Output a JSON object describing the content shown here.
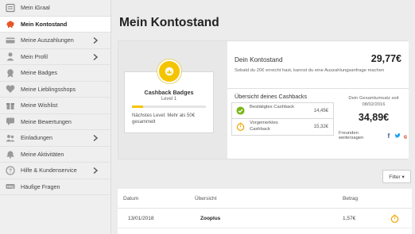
{
  "sidebar": {
    "items": [
      {
        "label": "Mein iGraal",
        "icon": "list-icon"
      },
      {
        "label": "Mein Kontostand",
        "icon": "piggy-bank-icon",
        "active": true
      },
      {
        "label": "Meine Auszahlungen",
        "icon": "card-icon",
        "expandable": true
      },
      {
        "label": "Mein Profil",
        "icon": "user-icon",
        "expandable": true
      },
      {
        "label": "Meine Badges",
        "icon": "badge-icon"
      },
      {
        "label": "Meine Lieblingsshops",
        "icon": "heart-icon"
      },
      {
        "label": "Meine Wishlist",
        "icon": "gift-icon"
      },
      {
        "label": "Meine Bewertungen",
        "icon": "chat-icon"
      },
      {
        "label": "Einladungen",
        "icon": "users-icon",
        "expandable": true
      },
      {
        "label": "Meine Aktivitäten",
        "icon": "bell-icon"
      },
      {
        "label": "Hilfe & Kundenservice",
        "icon": "help-icon",
        "expandable": true
      },
      {
        "label": "Häufige Fragen",
        "icon": "faq-icon"
      }
    ]
  },
  "page": {
    "title": "Mein Kontostand"
  },
  "badge": {
    "title": "Cashback Badges",
    "level": "Level 1",
    "progress": 0.15,
    "next_level": "Nächstes Level: Mehr als 50€ gesammelt"
  },
  "konto": {
    "label": "Dein Kontostand",
    "value": "29,77€",
    "note": "Sobald du 20€ erreicht hast, kannst du eine Auszahlungsanfrage machen"
  },
  "cashback": {
    "title": "Übersicht deines Cashbacks",
    "rows": [
      {
        "label": "Bestätigtes Cashback",
        "value": "14,45€",
        "icon": "check-circle-icon"
      },
      {
        "label": "Vorgemerktes Cashback",
        "value": "15,32€",
        "icon": "stopwatch-icon"
      }
    ],
    "total_label": "Dein Gesamtumsatz seit 08/02/2016",
    "total_value": "34,89€",
    "share_label": "Freunden weitersagen"
  },
  "filter": {
    "label": "Filter ▾"
  },
  "table": {
    "headers": [
      "Datum",
      "Übersicht",
      "Betrag"
    ],
    "rows": [
      {
        "date": "13/01/2018",
        "overview": "Zooplus",
        "amount": "1,57€",
        "status_icon": "stopwatch-icon"
      }
    ]
  },
  "colors": {
    "accent_yellow": "#f5c400",
    "confirmed_green": "#7cb518",
    "pending_orange": "#f0a500",
    "facebook": "#3b5998",
    "twitter": "#1da1f2",
    "google_plus": "#dd4b39"
  }
}
